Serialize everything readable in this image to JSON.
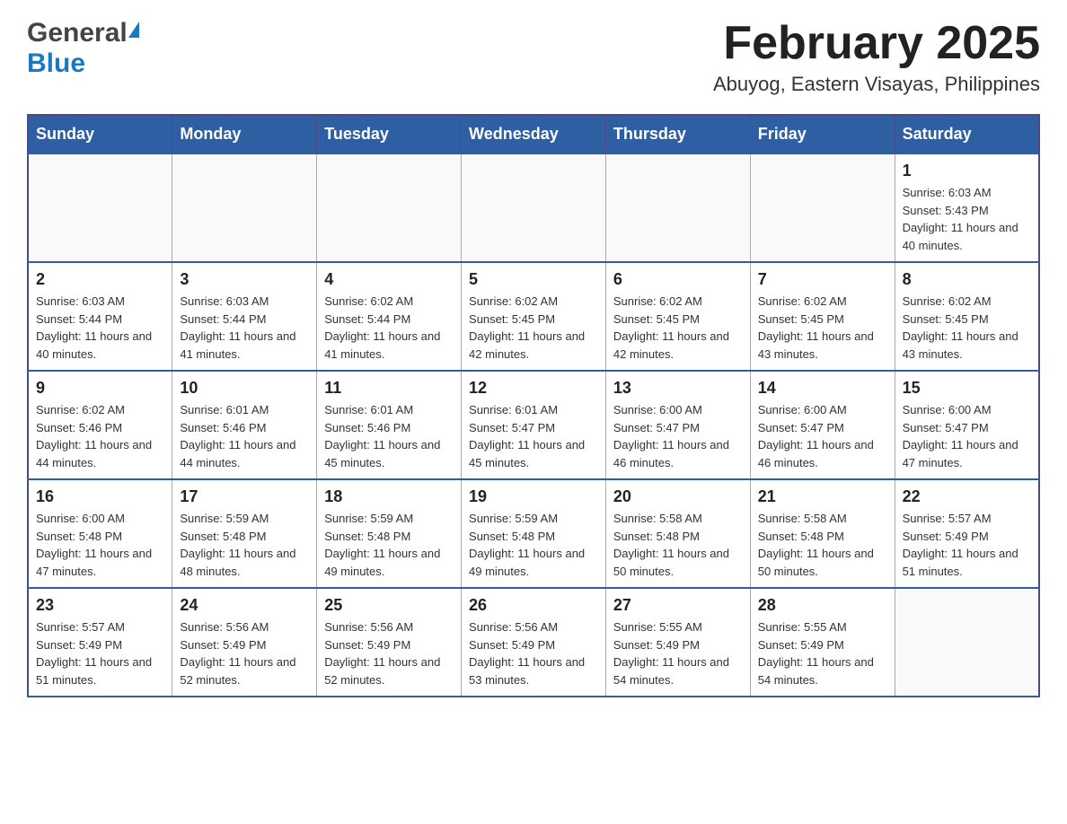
{
  "header": {
    "logo_general": "General",
    "logo_blue": "Blue",
    "month_title": "February 2025",
    "location": "Abuyog, Eastern Visayas, Philippines"
  },
  "weekdays": [
    "Sunday",
    "Monday",
    "Tuesday",
    "Wednesday",
    "Thursday",
    "Friday",
    "Saturday"
  ],
  "weeks": [
    {
      "days": [
        {
          "number": "",
          "info": ""
        },
        {
          "number": "",
          "info": ""
        },
        {
          "number": "",
          "info": ""
        },
        {
          "number": "",
          "info": ""
        },
        {
          "number": "",
          "info": ""
        },
        {
          "number": "",
          "info": ""
        },
        {
          "number": "1",
          "info": "Sunrise: 6:03 AM\nSunset: 5:43 PM\nDaylight: 11 hours and 40 minutes."
        }
      ]
    },
    {
      "days": [
        {
          "number": "2",
          "info": "Sunrise: 6:03 AM\nSunset: 5:44 PM\nDaylight: 11 hours and 40 minutes."
        },
        {
          "number": "3",
          "info": "Sunrise: 6:03 AM\nSunset: 5:44 PM\nDaylight: 11 hours and 41 minutes."
        },
        {
          "number": "4",
          "info": "Sunrise: 6:02 AM\nSunset: 5:44 PM\nDaylight: 11 hours and 41 minutes."
        },
        {
          "number": "5",
          "info": "Sunrise: 6:02 AM\nSunset: 5:45 PM\nDaylight: 11 hours and 42 minutes."
        },
        {
          "number": "6",
          "info": "Sunrise: 6:02 AM\nSunset: 5:45 PM\nDaylight: 11 hours and 42 minutes."
        },
        {
          "number": "7",
          "info": "Sunrise: 6:02 AM\nSunset: 5:45 PM\nDaylight: 11 hours and 43 minutes."
        },
        {
          "number": "8",
          "info": "Sunrise: 6:02 AM\nSunset: 5:45 PM\nDaylight: 11 hours and 43 minutes."
        }
      ]
    },
    {
      "days": [
        {
          "number": "9",
          "info": "Sunrise: 6:02 AM\nSunset: 5:46 PM\nDaylight: 11 hours and 44 minutes."
        },
        {
          "number": "10",
          "info": "Sunrise: 6:01 AM\nSunset: 5:46 PM\nDaylight: 11 hours and 44 minutes."
        },
        {
          "number": "11",
          "info": "Sunrise: 6:01 AM\nSunset: 5:46 PM\nDaylight: 11 hours and 45 minutes."
        },
        {
          "number": "12",
          "info": "Sunrise: 6:01 AM\nSunset: 5:47 PM\nDaylight: 11 hours and 45 minutes."
        },
        {
          "number": "13",
          "info": "Sunrise: 6:00 AM\nSunset: 5:47 PM\nDaylight: 11 hours and 46 minutes."
        },
        {
          "number": "14",
          "info": "Sunrise: 6:00 AM\nSunset: 5:47 PM\nDaylight: 11 hours and 46 minutes."
        },
        {
          "number": "15",
          "info": "Sunrise: 6:00 AM\nSunset: 5:47 PM\nDaylight: 11 hours and 47 minutes."
        }
      ]
    },
    {
      "days": [
        {
          "number": "16",
          "info": "Sunrise: 6:00 AM\nSunset: 5:48 PM\nDaylight: 11 hours and 47 minutes."
        },
        {
          "number": "17",
          "info": "Sunrise: 5:59 AM\nSunset: 5:48 PM\nDaylight: 11 hours and 48 minutes."
        },
        {
          "number": "18",
          "info": "Sunrise: 5:59 AM\nSunset: 5:48 PM\nDaylight: 11 hours and 49 minutes."
        },
        {
          "number": "19",
          "info": "Sunrise: 5:59 AM\nSunset: 5:48 PM\nDaylight: 11 hours and 49 minutes."
        },
        {
          "number": "20",
          "info": "Sunrise: 5:58 AM\nSunset: 5:48 PM\nDaylight: 11 hours and 50 minutes."
        },
        {
          "number": "21",
          "info": "Sunrise: 5:58 AM\nSunset: 5:48 PM\nDaylight: 11 hours and 50 minutes."
        },
        {
          "number": "22",
          "info": "Sunrise: 5:57 AM\nSunset: 5:49 PM\nDaylight: 11 hours and 51 minutes."
        }
      ]
    },
    {
      "days": [
        {
          "number": "23",
          "info": "Sunrise: 5:57 AM\nSunset: 5:49 PM\nDaylight: 11 hours and 51 minutes."
        },
        {
          "number": "24",
          "info": "Sunrise: 5:56 AM\nSunset: 5:49 PM\nDaylight: 11 hours and 52 minutes."
        },
        {
          "number": "25",
          "info": "Sunrise: 5:56 AM\nSunset: 5:49 PM\nDaylight: 11 hours and 52 minutes."
        },
        {
          "number": "26",
          "info": "Sunrise: 5:56 AM\nSunset: 5:49 PM\nDaylight: 11 hours and 53 minutes."
        },
        {
          "number": "27",
          "info": "Sunrise: 5:55 AM\nSunset: 5:49 PM\nDaylight: 11 hours and 54 minutes."
        },
        {
          "number": "28",
          "info": "Sunrise: 5:55 AM\nSunset: 5:49 PM\nDaylight: 11 hours and 54 minutes."
        },
        {
          "number": "",
          "info": ""
        }
      ]
    }
  ]
}
